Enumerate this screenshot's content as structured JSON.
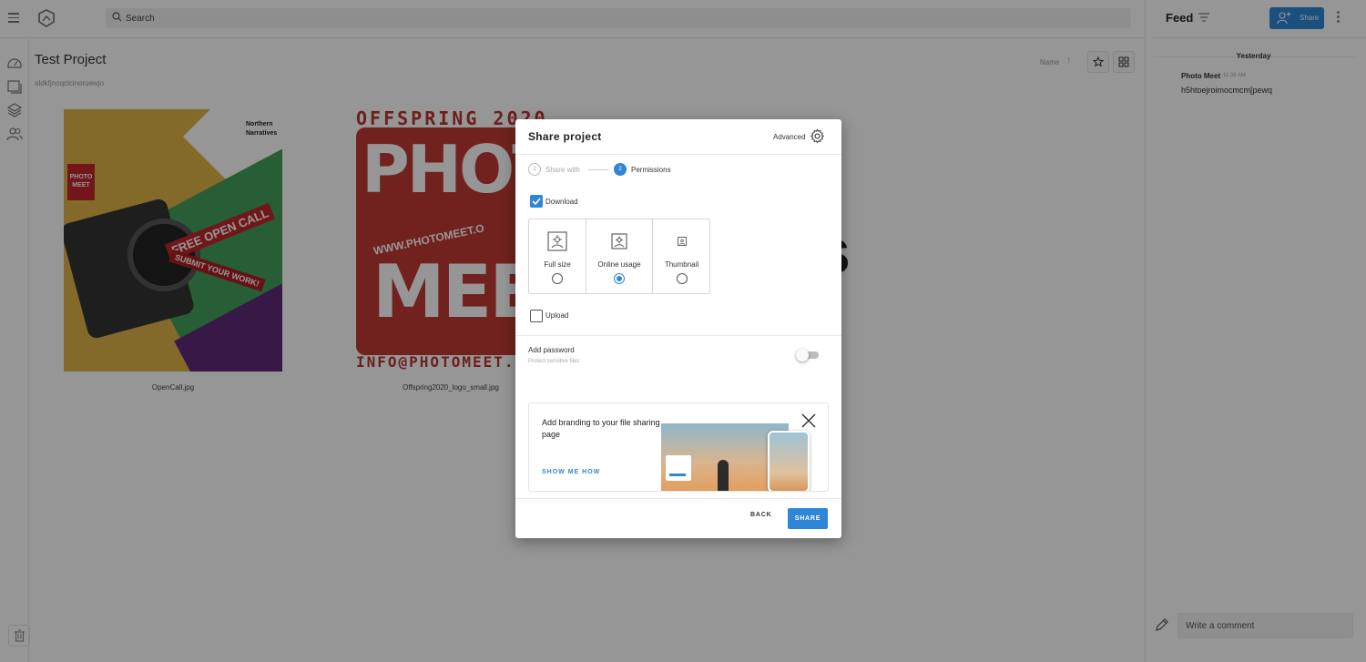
{
  "topbar": {
    "search_placeholder": "Search"
  },
  "project": {
    "title": "Test Project",
    "description": "aldkfjnoqcicinoruewjo",
    "sort_label": "Name",
    "files": [
      {
        "name": "OpenCall.jpg",
        "art": {
          "nn": "Northern\nNarratives",
          "logo": "PHOTO MEET",
          "banner1": "FREE OPEN CALL",
          "banner2": "SUBMIT YOUR WORK!"
        }
      },
      {
        "name": "Offspring2020_logo_small.jpg",
        "art": {
          "head": "OFFSPRING 2020",
          "photo": "PHOTO",
          "meet": "MEET",
          "www": "WWW.PHOTOMEET.O",
          "foot": "INFO@PHOTOMEET.C"
        }
      }
    ],
    "bg_letter": "s"
  },
  "feed": {
    "title": "Feed",
    "share_label": "Share",
    "day": "Yesterday",
    "entry": {
      "author": "Photo Meet",
      "time": "11:38 AM",
      "message": "h5htoejroimocmcm[pewq"
    },
    "comment_placeholder": "Write a comment"
  },
  "modal": {
    "title": "Share project",
    "advanced_label": "Advanced",
    "steps": [
      {
        "number": "1",
        "label": "Share with",
        "active": false
      },
      {
        "number": "2",
        "label": "Permissions",
        "active": true
      }
    ],
    "download_label": "Download",
    "download_checked": true,
    "permissions": [
      {
        "label": "Full size",
        "selected": false
      },
      {
        "label": "Online usage",
        "selected": true
      },
      {
        "label": "Thumbnail",
        "selected": false
      }
    ],
    "upload_label": "Upload",
    "upload_checked": false,
    "password_title": "Add password",
    "password_subtitle": "Protect sensitive files",
    "password_enabled": false,
    "branding_text": "Add branding to your file sharing page",
    "branding_link": "SHOW ME HOW",
    "back_label": "BACK",
    "share_label": "SHARE"
  },
  "colors": {
    "accent": "#2f86d6",
    "overlay": "rgba(0,0,0,0.41)"
  }
}
